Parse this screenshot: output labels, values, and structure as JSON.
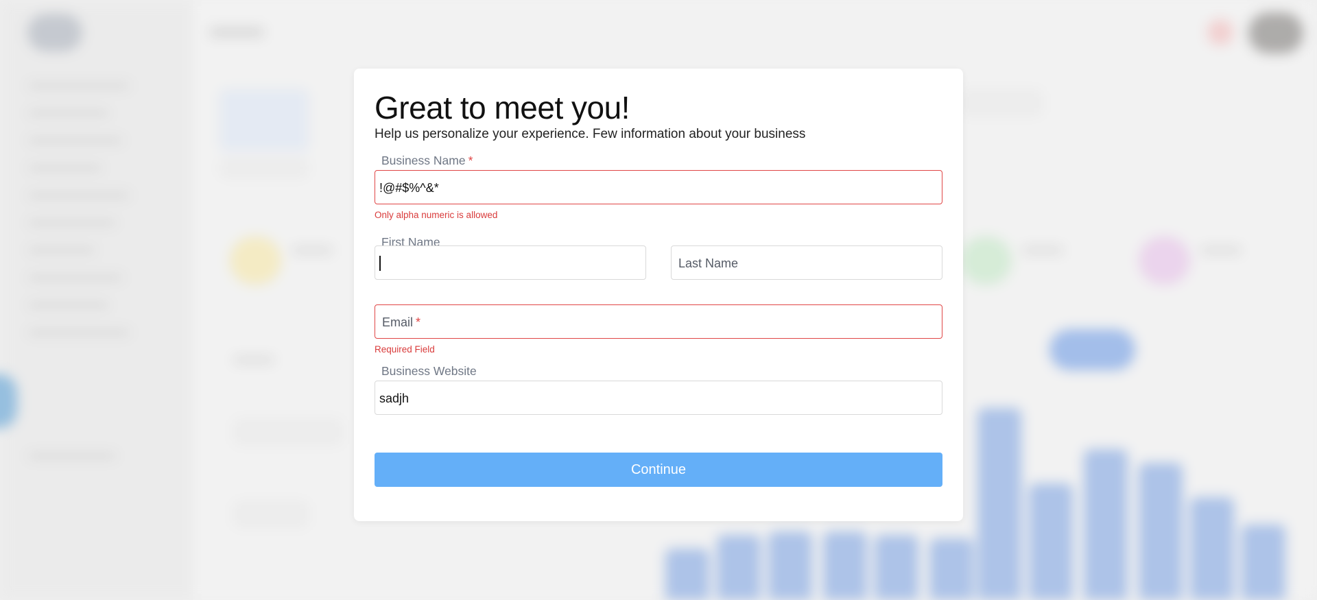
{
  "modal": {
    "title": "Great to meet you!",
    "subtitle": "Help us personalize your experience. Few information about your business"
  },
  "form": {
    "business_name": {
      "label": "Business Name",
      "required_mark": "*",
      "value": "!@#$%^&*",
      "error": "Only alpha numeric is allowed"
    },
    "first_name": {
      "label": "First Name",
      "value": ""
    },
    "last_name": {
      "placeholder": "Last Name",
      "value": ""
    },
    "email": {
      "placeholder": "Email",
      "required_mark": "*",
      "value": "",
      "error": "Required Field"
    },
    "business_website": {
      "label": "Business Website",
      "value": "sadjh"
    },
    "continue_label": "Continue"
  },
  "colors": {
    "error": "#e04545",
    "primary_button": "#64aff8",
    "label": "#6f7785"
  }
}
